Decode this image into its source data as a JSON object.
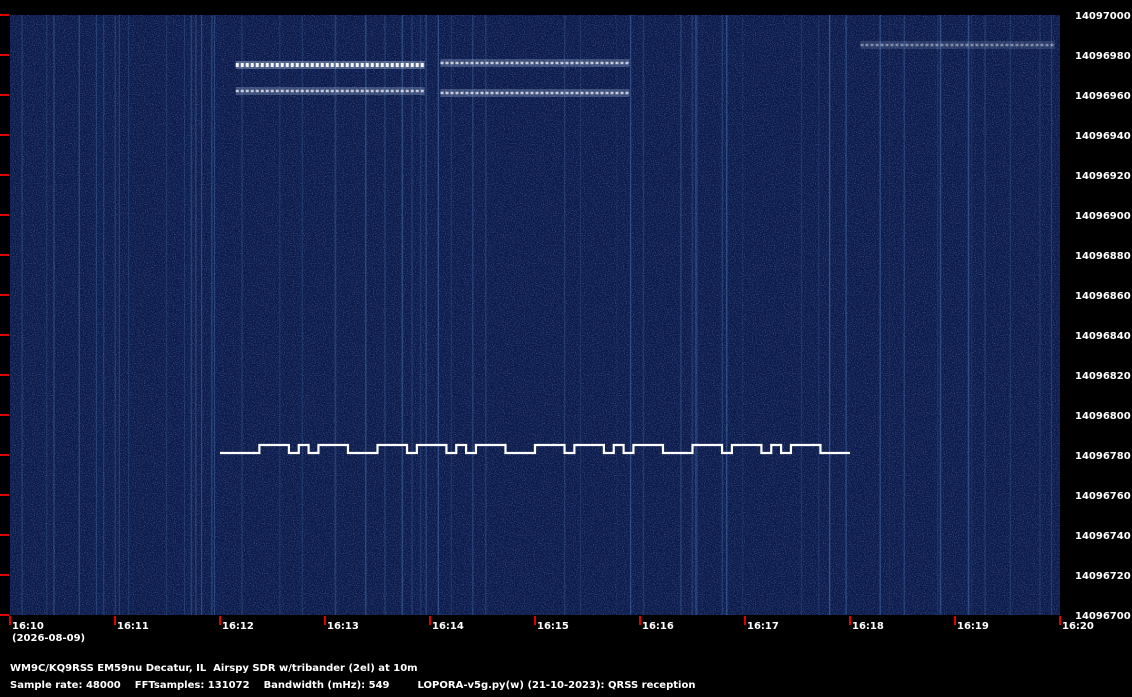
{
  "chart_data": {
    "type": "heatmap",
    "subtype": "spectrogram",
    "date": "(2026-08-09)",
    "x_ticks": [
      "16:10",
      "16:11",
      "16:12",
      "16:13",
      "16:14",
      "16:15",
      "16:16",
      "16:17",
      "16:18",
      "16:19",
      "16:20"
    ],
    "y_ticks": [
      "14097000",
      "14096980",
      "14096960",
      "14096940",
      "14096920",
      "14096900",
      "14096880",
      "14096860",
      "14096840",
      "14096820",
      "14096800",
      "14096780",
      "14096760",
      "14096740",
      "14096720",
      "14096700"
    ],
    "x_range_min": [
      970,
      980
    ],
    "y_range_hz": [
      14096700,
      14097000
    ],
    "colors": {
      "background": "#0b1a4a",
      "signal": "#ffffff",
      "tick": "#e00000",
      "noise": "#4f7fc0"
    },
    "fsk_trace": {
      "base_hz": 14096781,
      "shift_hz": 4,
      "start_min": 972.0,
      "end_min": 978.0,
      "bits": [
        0,
        0,
        0,
        0,
        1,
        1,
        1,
        0,
        1,
        0,
        1,
        1,
        1,
        0,
        0,
        0,
        1,
        1,
        1,
        0,
        1,
        1,
        1,
        0,
        1,
        0,
        1,
        1,
        1,
        0,
        0,
        0,
        1,
        1,
        1,
        0,
        1,
        1,
        1,
        0,
        1,
        0,
        1,
        1,
        1,
        0,
        0,
        0,
        1,
        1,
        1,
        0,
        1,
        1,
        1,
        0,
        1,
        0,
        1,
        1,
        1,
        0,
        0,
        0
      ]
    },
    "signal_bands": [
      {
        "start_min": 972.15,
        "end_min": 973.95,
        "hz": 14096975,
        "strength": "strong"
      },
      {
        "start_min": 972.15,
        "end_min": 973.95,
        "hz": 14096962,
        "strength": "medium"
      },
      {
        "start_min": 974.1,
        "end_min": 975.9,
        "hz": 14096976,
        "strength": "medium"
      },
      {
        "start_min": 974.1,
        "end_min": 975.9,
        "hz": 14096961,
        "strength": "medium"
      },
      {
        "start_min": 978.1,
        "end_min": 979.95,
        "hz": 14096985,
        "strength": "weak"
      }
    ]
  },
  "footer": {
    "station": "WM9C/KQ9RSS EM59nu Decatur, IL  Airspy SDR w/tribander (2el) at 10m",
    "sample_rate": "Sample rate: 48000",
    "fft": "FFTsamples: 131072",
    "bandwidth": "Bandwidth (mHz): 549",
    "software": "LOPORA-v5g.py(w) (21-10-2023): QRSS reception"
  }
}
